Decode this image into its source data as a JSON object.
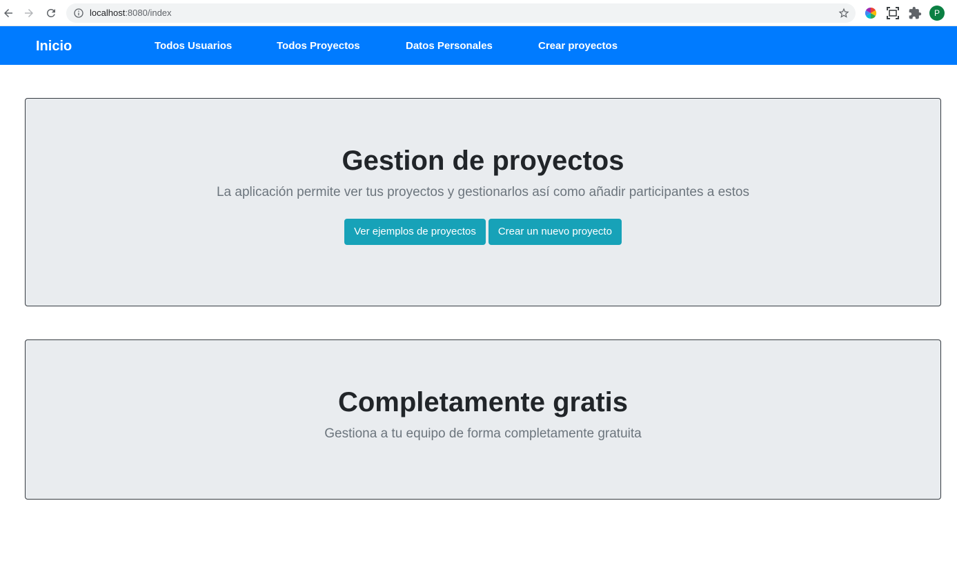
{
  "browser": {
    "url_host": "localhost",
    "url_path": ":8080/index",
    "profile_initial": "P",
    "icons": {
      "back": "back-arrow-icon",
      "forward": "forward-arrow-icon",
      "reload": "reload-icon",
      "info": "info-icon",
      "bookmark": "star-icon",
      "color_extension": "color-wheel-icon",
      "screenshot_extension": "screenshot-icon",
      "extensions": "puzzle-icon"
    }
  },
  "navbar": {
    "brand": "Inicio",
    "links": [
      "Todos Usuarios",
      "Todos Proyectos",
      "Datos Personales",
      "Crear proyectos"
    ],
    "background_color": "#007bff"
  },
  "hero": {
    "title": "Gestion de proyectos",
    "lead": "La aplicación permite ver tus proyectos y gestionarlos así como añadir participantes a estos",
    "buttons": [
      "Ver ejemplos de proyectos",
      "Crear un nuevo proyecto"
    ],
    "button_color": "#17a2b8"
  },
  "free_section": {
    "title": "Completamente gratis",
    "lead": "Gestiona a tu equipo de forma completamente gratuita"
  }
}
